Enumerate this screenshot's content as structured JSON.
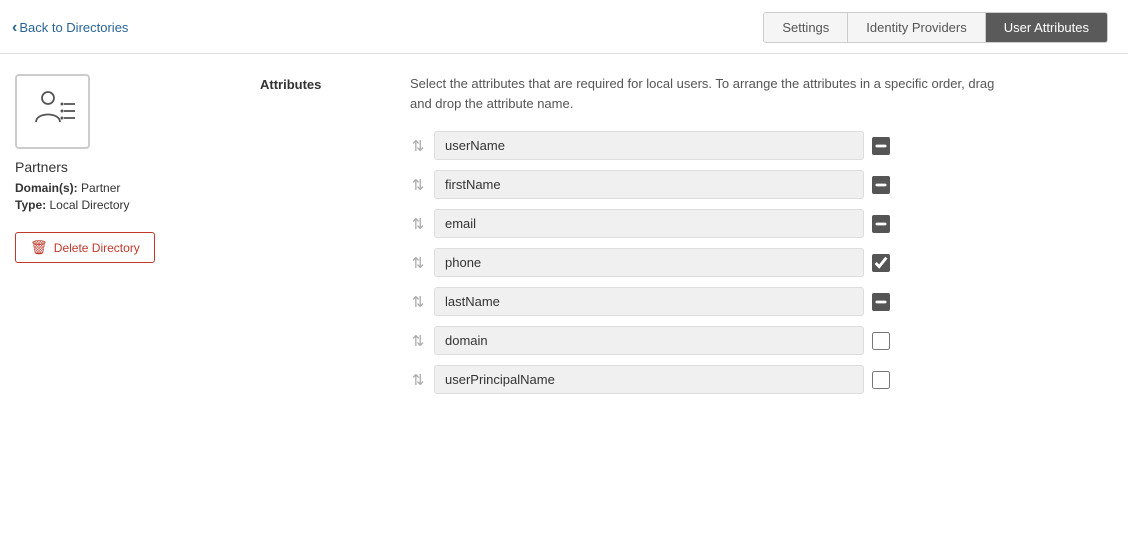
{
  "header": {
    "back_label": "Back to Directories",
    "tabs": [
      {
        "id": "settings",
        "label": "Settings",
        "active": false
      },
      {
        "id": "identity-providers",
        "label": "Identity Providers",
        "active": false
      },
      {
        "id": "user-attributes",
        "label": "User Attributes",
        "active": true
      }
    ]
  },
  "sidebar": {
    "directory_name": "Partners",
    "domain_label": "Domain(s):",
    "domain_value": "Partner",
    "type_label": "Type:",
    "type_value": "Local Directory",
    "delete_button_label": "Delete Directory"
  },
  "content": {
    "section_label": "Attributes",
    "description": "Select the attributes that are required for local users. To arrange the attributes in a specific order, drag and drop the attribute name.",
    "attributes": [
      {
        "name": "userName",
        "checked": true,
        "indeterminate": true
      },
      {
        "name": "firstName",
        "checked": true,
        "indeterminate": true
      },
      {
        "name": "email",
        "checked": true,
        "indeterminate": true
      },
      {
        "name": "phone",
        "checked": true,
        "indeterminate": false
      },
      {
        "name": "lastName",
        "checked": true,
        "indeterminate": true
      },
      {
        "name": "domain",
        "checked": false,
        "indeterminate": false
      },
      {
        "name": "userPrincipalName",
        "checked": false,
        "indeterminate": false
      }
    ]
  }
}
